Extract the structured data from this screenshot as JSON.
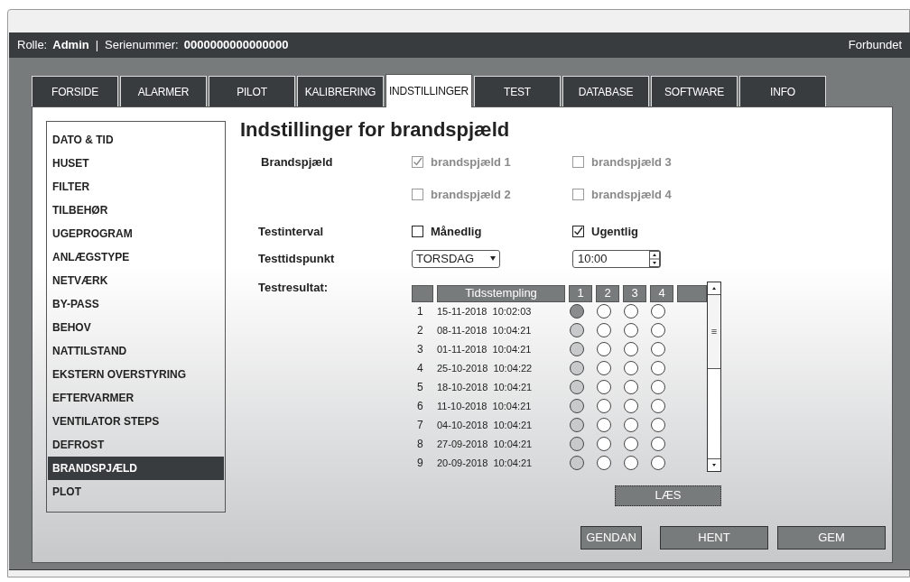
{
  "header": {
    "role_label": "Rolle:",
    "role": "Admin",
    "separator": "|",
    "serial_label": "Serienummer:",
    "serial": "0000000000000000",
    "status": "Forbundet"
  },
  "tabs": [
    {
      "label": "FORSIDE",
      "selected": false
    },
    {
      "label": "ALARMER",
      "selected": false
    },
    {
      "label": "PILOT",
      "selected": false
    },
    {
      "label": "KALIBRERING",
      "selected": false
    },
    {
      "label": "INDSTILLINGER",
      "selected": true
    },
    {
      "label": "TEST",
      "selected": false
    },
    {
      "label": "DATABASE",
      "selected": false
    },
    {
      "label": "SOFTWARE",
      "selected": false
    },
    {
      "label": "INFO",
      "selected": false
    }
  ],
  "sidebar": {
    "items": [
      {
        "label": "DATO & TID",
        "selected": false
      },
      {
        "label": "HUSET",
        "selected": false
      },
      {
        "label": "FILTER",
        "selected": false
      },
      {
        "label": "TILBEHØR",
        "selected": false
      },
      {
        "label": "UGEPROGRAM",
        "selected": false
      },
      {
        "label": "ANLÆGSTYPE",
        "selected": false
      },
      {
        "label": "NETVÆRK",
        "selected": false
      },
      {
        "label": "BY-PASS",
        "selected": false
      },
      {
        "label": "BEHOV",
        "selected": false
      },
      {
        "label": "NATTILSTAND",
        "selected": false
      },
      {
        "label": "EKSTERN OVERSTYRING",
        "selected": false
      },
      {
        "label": "EFTERVARMER",
        "selected": false
      },
      {
        "label": "VENTILATOR STEPS",
        "selected": false
      },
      {
        "label": "DEFROST",
        "selected": false
      },
      {
        "label": "BRANDSPJÆLD",
        "selected": true
      },
      {
        "label": "PLOT",
        "selected": false
      }
    ]
  },
  "title": "Indstillinger for brandspjæld",
  "dampers": {
    "label": "Brandspjæld",
    "options": [
      {
        "label": "brandspjæld 1",
        "checked": true,
        "disabled": true
      },
      {
        "label": "brandspjæld 3",
        "checked": false,
        "disabled": true
      },
      {
        "label": "brandspjæld 2",
        "checked": false,
        "disabled": true
      },
      {
        "label": "brandspjæld 4",
        "checked": false,
        "disabled": true
      }
    ]
  },
  "interval": {
    "label": "Testinterval",
    "options": [
      {
        "label": "Månedlig",
        "checked": false,
        "disabled": false
      },
      {
        "label": "Ugentlig",
        "checked": true,
        "disabled": false
      }
    ]
  },
  "time": {
    "label": "Testtidspunkt",
    "day": "TORSDAG",
    "clock": "10:00"
  },
  "results": {
    "label": "Testresultat:",
    "columns": [
      "Tidsstempling",
      "1",
      "2",
      "3",
      "4"
    ],
    "rows": [
      {
        "index": "1",
        "timestamp": "15-11-2018  10:02:03",
        "dots": [
          {
            "kind": "latest"
          },
          {
            "kind": "none"
          },
          {
            "kind": "none"
          },
          {
            "kind": "none"
          }
        ]
      },
      {
        "index": "2",
        "timestamp": "08-11-2018  10:04:21",
        "dots": [
          {
            "kind": "pass"
          },
          {
            "kind": "none"
          },
          {
            "kind": "none"
          },
          {
            "kind": "none"
          }
        ]
      },
      {
        "index": "3",
        "timestamp": "01-11-2018  10:04:21",
        "dots": [
          {
            "kind": "pass"
          },
          {
            "kind": "none"
          },
          {
            "kind": "none"
          },
          {
            "kind": "none"
          }
        ]
      },
      {
        "index": "4",
        "timestamp": "25-10-2018  10:04:22",
        "dots": [
          {
            "kind": "pass"
          },
          {
            "kind": "none"
          },
          {
            "kind": "none"
          },
          {
            "kind": "none"
          }
        ]
      },
      {
        "index": "5",
        "timestamp": "18-10-2018  10:04:21",
        "dots": [
          {
            "kind": "pass"
          },
          {
            "kind": "none"
          },
          {
            "kind": "none"
          },
          {
            "kind": "none"
          }
        ]
      },
      {
        "index": "6",
        "timestamp": "11-10-2018  10:04:21",
        "dots": [
          {
            "kind": "pass"
          },
          {
            "kind": "none"
          },
          {
            "kind": "none"
          },
          {
            "kind": "none"
          }
        ]
      },
      {
        "index": "7",
        "timestamp": "04-10-2018  10:04:21",
        "dots": [
          {
            "kind": "pass"
          },
          {
            "kind": "none"
          },
          {
            "kind": "none"
          },
          {
            "kind": "none"
          }
        ]
      },
      {
        "index": "8",
        "timestamp": "27-09-2018  10:04:21",
        "dots": [
          {
            "kind": "pass"
          },
          {
            "kind": "none"
          },
          {
            "kind": "none"
          },
          {
            "kind": "none"
          }
        ]
      },
      {
        "index": "9",
        "timestamp": "20-09-2018  10:04:21",
        "dots": [
          {
            "kind": "pass"
          },
          {
            "kind": "none"
          },
          {
            "kind": "none"
          },
          {
            "kind": "none"
          }
        ]
      }
    ],
    "scroll_grip": "≡",
    "read_button": "LÆS"
  },
  "buttons": [
    "GENDAN",
    "HENT",
    "GEM"
  ]
}
